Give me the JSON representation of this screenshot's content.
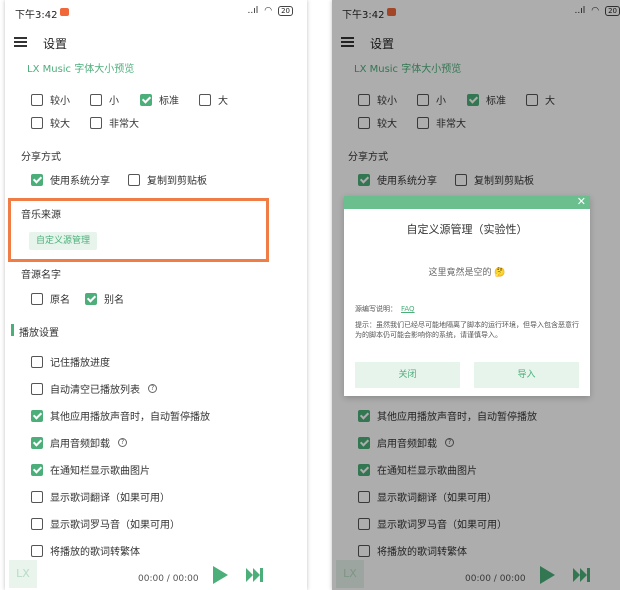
{
  "status": {
    "time": "下午3:42",
    "signal": "..ıl",
    "battery": "20"
  },
  "topbar": {
    "title": "设置"
  },
  "preview": "LX Music 字体大小预览",
  "font_sizes": [
    {
      "label": "较小",
      "checked": false
    },
    {
      "label": "小",
      "checked": false
    },
    {
      "label": "标准",
      "checked": true
    },
    {
      "label": "大",
      "checked": false
    },
    {
      "label": "较大",
      "checked": false
    },
    {
      "label": "非常大",
      "checked": false
    }
  ],
  "share": {
    "title": "分享方式",
    "options": [
      {
        "label": "使用系统分享",
        "checked": true
      },
      {
        "label": "复制到剪贴板",
        "checked": false
      }
    ]
  },
  "music_source": {
    "title": "音乐来源",
    "button": "自定义源管理"
  },
  "source_name": {
    "title": "音源名字",
    "options": [
      {
        "label": "原名",
        "checked": false
      },
      {
        "label": "别名",
        "checked": true
      }
    ]
  },
  "playback": {
    "title": "播放设置",
    "options": [
      {
        "label": "记住播放进度",
        "checked": false
      },
      {
        "label": "自动清空已播放列表",
        "checked": false,
        "help": "?"
      },
      {
        "label": "其他应用播放声音时，自动暂停播放",
        "checked": true
      },
      {
        "label": "启用音频卸载",
        "checked": true,
        "help": "?"
      },
      {
        "label": "在通知栏显示歌曲图片",
        "checked": true
      },
      {
        "label": "显示歌词翻译（如果可用）",
        "checked": false
      },
      {
        "label": "显示歌词罗马音（如果可用）",
        "checked": false
      },
      {
        "label": "将播放的歌词转繁体",
        "checked": false
      }
    ]
  },
  "player": {
    "logo": "LX",
    "time": "00:00 / 00:00"
  },
  "dialog": {
    "close_glyph": "✕",
    "title": "自定义源管理（实验性）",
    "empty": "这里竟然是空的 🤔",
    "help_label": "源编写说明：",
    "help_link": "FAQ",
    "tip": "提示：虽然我们已经尽可能地隔离了脚本的运行环境，但导入包含恶意行为的脚本仍可能会影响你的系统，请谨慎导入。",
    "close_button": "关闭",
    "import_button": "导入"
  },
  "colors": {
    "accent": "#4caf7a",
    "highlight": "#f07d46"
  }
}
